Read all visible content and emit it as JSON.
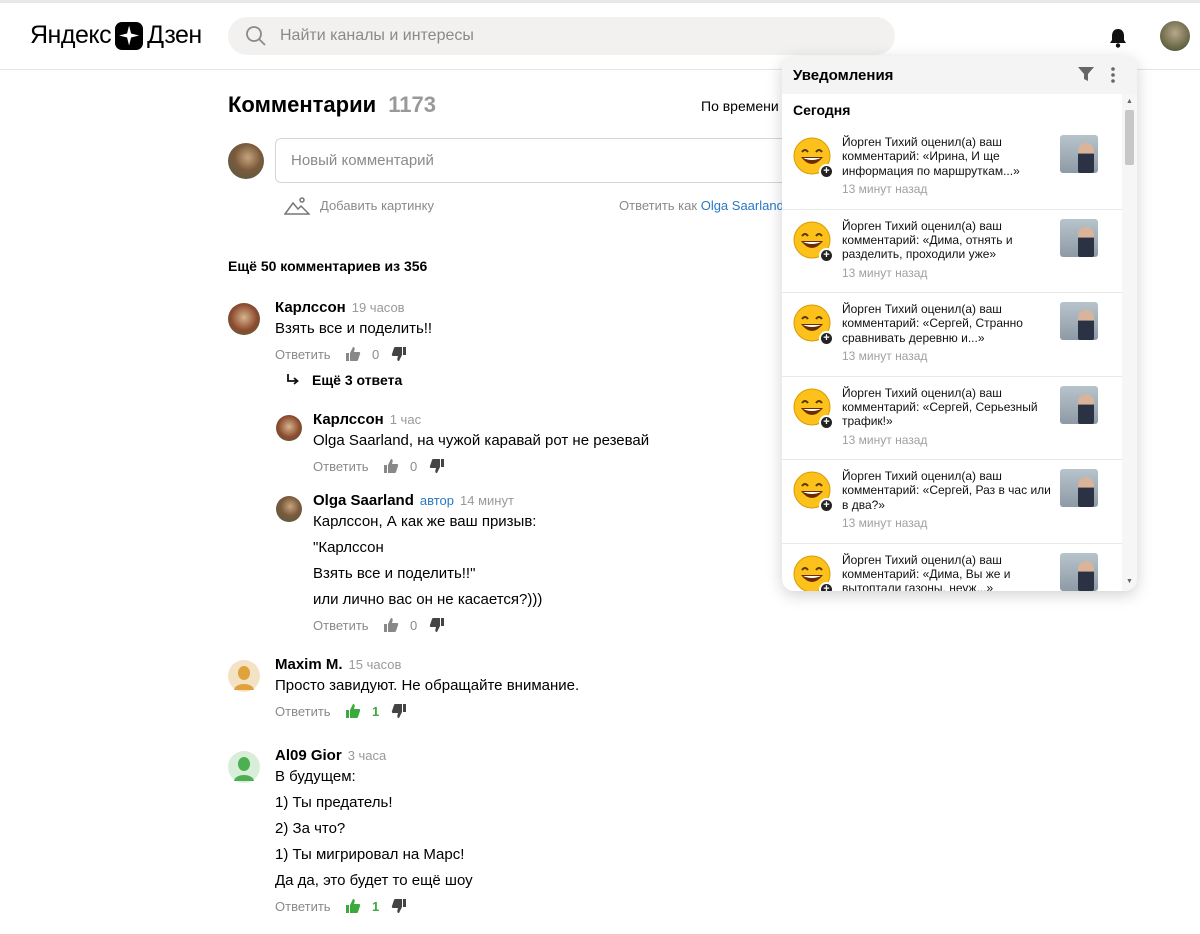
{
  "header": {
    "logo_left": "Яндекс",
    "logo_right": "Дзен",
    "search_placeholder": "Найти каналы и интересы"
  },
  "comments_section": {
    "title": "Комментарии",
    "count": "1173",
    "sort_label": "По времени",
    "new_comment_placeholder": "Новый комментарий",
    "add_picture_label": "Добавить картинку",
    "reply_as_prefix": "Ответить как",
    "reply_as_user": "Olga Saarland",
    "more_comments": "Ещё 50 комментариев из 356",
    "reply_label": "Ответить",
    "more_replies": "Ещё 3 ответа"
  },
  "comments": [
    {
      "author": "Карлссон",
      "time": "19 часов",
      "lines": [
        "Взять все и поделить!!"
      ],
      "likes": "0"
    },
    {
      "author": "Карлссон",
      "time": "1 час",
      "lines": [
        "Olga Saarland, на чужой каравай рот не резевай"
      ],
      "likes": "0"
    },
    {
      "author": "Olga Saarland",
      "tag": "автор",
      "time": "14 минут",
      "lines": [
        "Карлссон, А как же ваш призыв:",
        "\"Карлссон",
        "Взять все и поделить!!\"",
        "или лично вас он не касается?)))"
      ],
      "likes": "0"
    },
    {
      "author": "Maxim M.",
      "time": "15 часов",
      "lines": [
        "Просто завидуют. Не обращайте внимание."
      ],
      "likes": "1"
    },
    {
      "author": "Al09 Gior",
      "time": "3 часа",
      "lines": [
        "В будущем:",
        "1) Ты предатель!",
        "2) За что?",
        "1) Ты мигрировал на Марс!",
        "Да да, это будет то ещё шоу"
      ],
      "likes": "1"
    }
  ],
  "notifications": {
    "title": "Уведомления",
    "section": "Сегодня",
    "items": [
      {
        "text": "Йорген Тихий оценил(а) ваш комментарий: «Ирина, И ще информация по маршруткам...»",
        "time": "13 минут назад"
      },
      {
        "text": "Йорген Тихий оценил(а) ваш комментарий: «Дима, отнять и разделить, проходили уже»",
        "time": "13 минут назад"
      },
      {
        "text": "Йорген Тихий оценил(а) ваш комментарий: «Сергей, Странно сравнивать деревню и...»",
        "time": "13 минут назад"
      },
      {
        "text": "Йорген Тихий оценил(а) ваш комментарий: «Сергей, Серьезный трафик!»",
        "time": "13 минут назад"
      },
      {
        "text": "Йорген Тихий оценил(а) ваш комментарий: «Сергей, Раз в час или в два?»",
        "time": "13 минут назад"
      },
      {
        "text": "Йорген Тихий оценил(а) ваш комментарий: «Дима, Вы же и вытоптали газоны, неуж...»",
        "time": ""
      }
    ]
  }
}
